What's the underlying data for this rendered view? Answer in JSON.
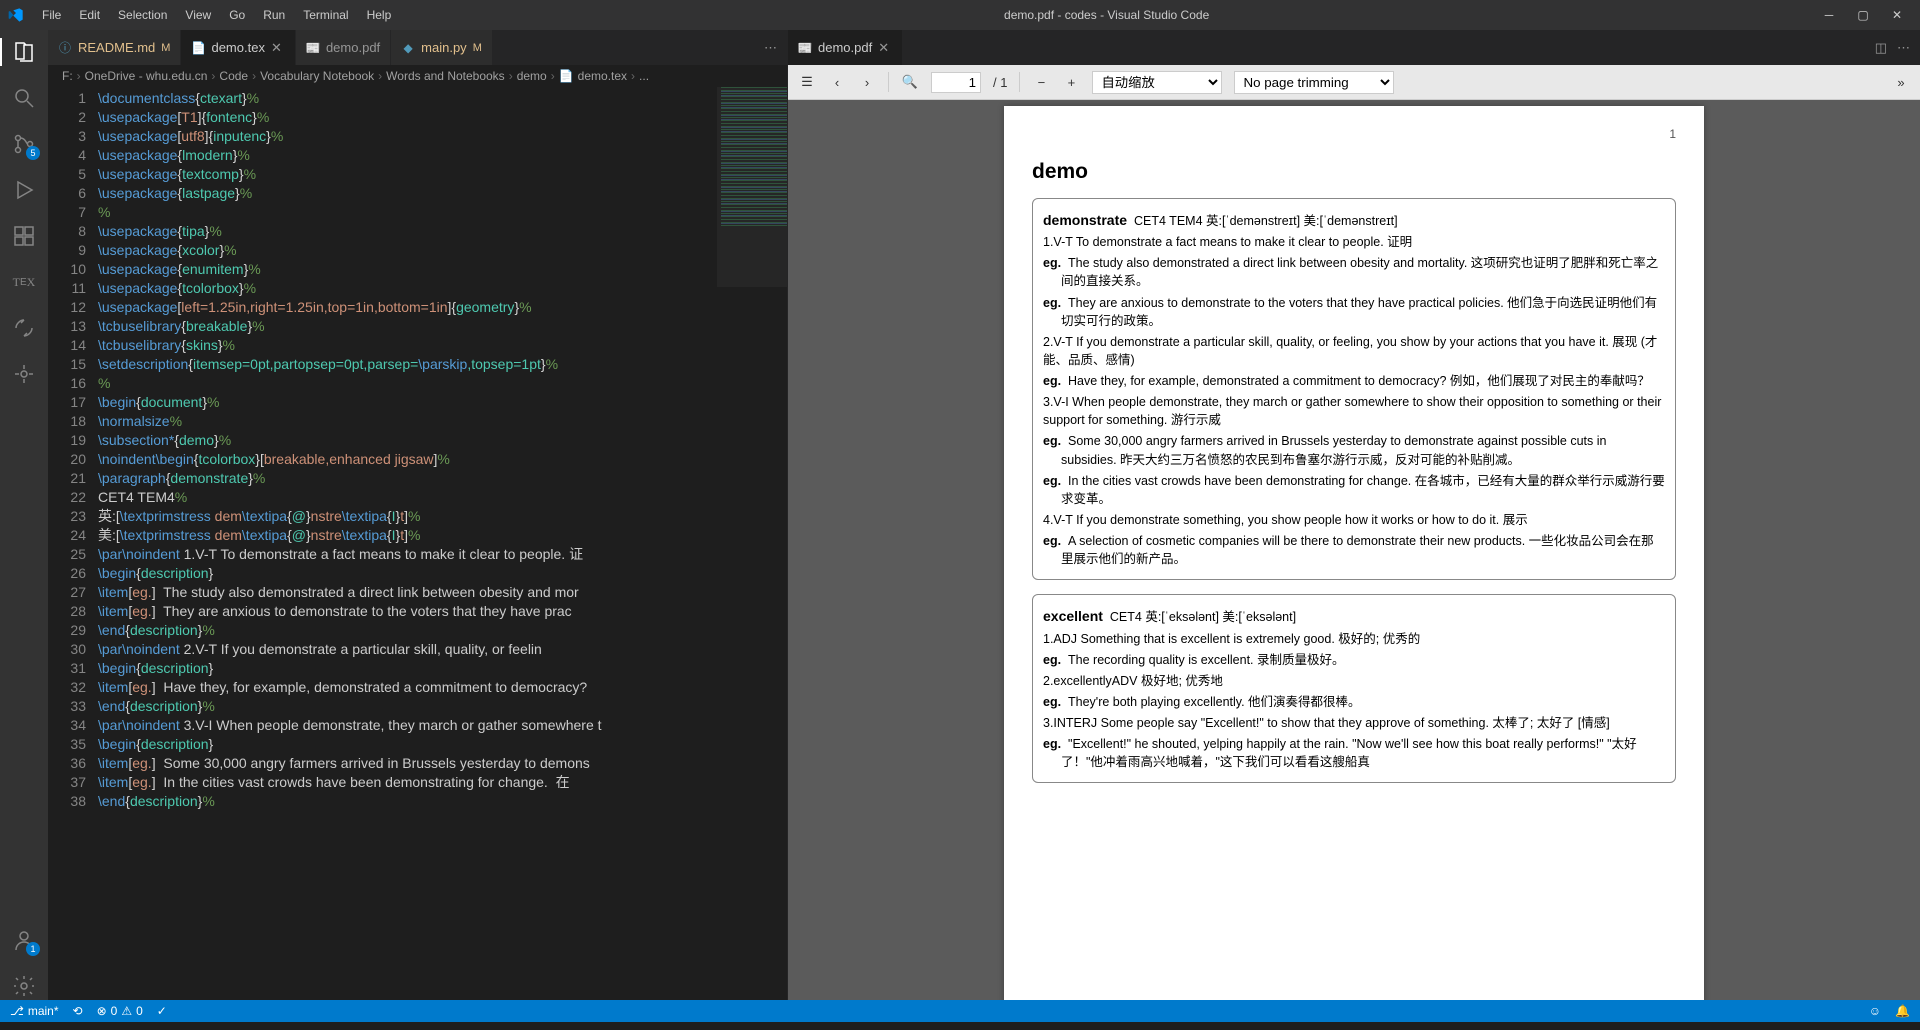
{
  "window_title": "demo.pdf - codes - Visual Studio Code",
  "menu": [
    "File",
    "Edit",
    "Selection",
    "View",
    "Go",
    "Run",
    "Terminal",
    "Help"
  ],
  "activity_badges": {
    "scm": "5",
    "account": "1"
  },
  "tabs_left": [
    {
      "icon": "ⓘ",
      "name": "README.md",
      "mod": "M",
      "active": false,
      "color": "#519aba"
    },
    {
      "icon": "T",
      "name": "demo.tex",
      "mod": "",
      "close": true,
      "active": true,
      "color": "#6c8b3c"
    },
    {
      "icon": "📄",
      "name": "demo.pdf",
      "mod": "",
      "active": false,
      "color": "#969696",
      "dim": true
    },
    {
      "icon": "🐍",
      "name": "main.py",
      "mod": "M",
      "active": false,
      "color": "#519aba"
    }
  ],
  "tabs_right": [
    {
      "icon": "📄",
      "name": "demo.pdf",
      "close": true,
      "active": true
    }
  ],
  "breadcrumb": [
    "F:",
    "OneDrive - whu.edu.cn",
    "Code",
    "Vocabulary Notebook",
    "Words and Notebooks",
    "demo",
    "demo.tex",
    "..."
  ],
  "code_lines": [
    "\\documentclass{ctexart}%",
    "\\usepackage[T1]{fontenc}%",
    "\\usepackage[utf8]{inputenc}%",
    "\\usepackage{lmodern}%",
    "\\usepackage{textcomp}%",
    "\\usepackage{lastpage}%",
    "%",
    "\\usepackage{tipa}%",
    "\\usepackage{xcolor}%",
    "\\usepackage{enumitem}%",
    "\\usepackage{tcolorbox}%",
    "\\usepackage[left=1.25in,right=1.25in,top=1in,bottom=1in]{geometry}%",
    "\\tcbuselibrary{breakable}%",
    "\\tcbuselibrary{skins}%",
    "\\setdescription{itemsep=0pt,partopsep=0pt,parsep=\\parskip,topsep=1pt}%",
    "%",
    "\\begin{document}%",
    "\\normalsize%",
    "\\subsection*{demo}%",
    "\\noindent\\begin{tcolorbox}[breakable,enhanced jigsaw]%",
    "\\paragraph{demonstrate}%",
    "CET4 TEM4%",
    "英:[\\textprimstress dem\\textipa{@}nstre\\textipa{I}t]%",
    "美:[\\textprimstress dem\\textipa{@}nstre\\textipa{I}t]%",
    "\\par\\noindent 1.V-T To demonstrate a fact means to make it clear to people. 证",
    "\\begin{description}",
    "\\item[eg.]  The study also demonstrated a direct link between obesity and mor",
    "\\item[eg.]  They are anxious to demonstrate to the voters that they have prac",
    "\\end{description}%",
    "\\par\\noindent 2.V-T If you demonstrate a particular skill, quality, or feelin",
    "\\begin{description}",
    "\\item[eg.]  Have they, for example, demonstrated a commitment to democracy?  ",
    "\\end{description}%",
    "\\par\\noindent 3.V-I When people demonstrate, they march or gather somewhere t",
    "\\begin{description}",
    "\\item[eg.]  Some 30,000 angry farmers arrived in Brussels yesterday to demons",
    "\\item[eg.]  In the cities vast crowds have been demonstrating for change.  在",
    "\\end{description}%"
  ],
  "pdf": {
    "page_current": "1",
    "page_total": "/ 1",
    "zoom_select": "自动缩放",
    "trim_select": "No page trimming",
    "page_number_display": "1",
    "heading": "demo",
    "word1": {
      "head": "demonstrate",
      "tags": "CET4 TEM4 英:[ˈdemənstreɪt] 美:[ˈdemənstreɪt]",
      "d1": "1.V-T To demonstrate a fact means to make it clear to people. 证明",
      "e1": "The study also demonstrated a direct link between obesity and mortality. 这项研究也证明了肥胖和死亡率之间的直接关系。",
      "e2": "They are anxious to demonstrate to the voters that they have practical policies. 他们急于向选民证明他们有切实可行的政策。",
      "d2": "2.V-T If you demonstrate a particular skill, quality, or feeling, you show by your actions that you have it. 展现 (才能、品质、感情)",
      "e3": "Have they, for example, demonstrated a commitment to democracy? 例如，他们展现了对民主的奉献吗？",
      "d3": "3.V-I When people demonstrate, they march or gather somewhere to show their opposition to something or their support for something. 游行示威",
      "e4": "Some 30,000 angry farmers arrived in Brussels yesterday to demonstrate against possible cuts in subsidies. 昨天大约三万名愤怒的农民到布鲁塞尔游行示威，反对可能的补贴削减。",
      "e5": "In the cities vast crowds have been demonstrating for change. 在各城市，已经有大量的群众举行示威游行要求变革。",
      "d4": "4.V-T If you demonstrate something, you show people how it works or how to do it. 展示",
      "e6": "A selection of cosmetic companies will be there to demonstrate their new products. 一些化妆品公司会在那里展示他们的新产品。"
    },
    "word2": {
      "head": "excellent",
      "tags": "CET4 英:[ˈeksələnt] 美:[ˈeksələnt]",
      "d1": "1.ADJ Something that is excellent is extremely good. 极好的; 优秀的",
      "e1": "The recording quality is excellent. 录制质量极好。",
      "d2": "2.excellentlyADV 极好地; 优秀地",
      "e2": "They're both playing excellently. 他们演奏得都很棒。",
      "d3": "3.INTERJ Some people say \"Excellent!\" to show that they approve of something. 太棒了; 太好了 [情感]",
      "e3": "\"Excellent!\" he shouted, yelping happily at the rain. \"Now we'll see how this boat really performs!\" \"太好了！\"他冲着雨高兴地喊着，\"这下我们可以看看这艘船真"
    }
  },
  "status": {
    "branch": "main*",
    "sync": "⟲",
    "errors": "0",
    "warnings": "0",
    "check": "✓"
  }
}
